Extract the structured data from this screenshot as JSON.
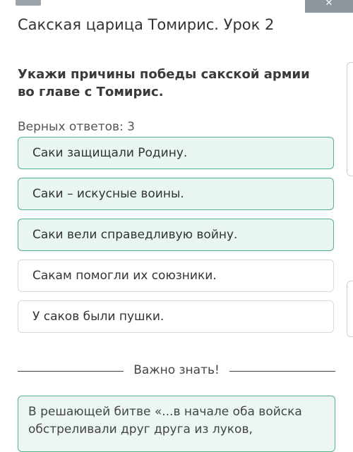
{
  "header": {
    "lesson_title": "Сакская царица Томирис. Урок 2"
  },
  "question": {
    "text": "Укажи причины победы сакской армии во главе с Томирис.",
    "correct_count_label": "Верных ответов: 3"
  },
  "answers": [
    {
      "label": "Саки защищали Родину.",
      "selected": true
    },
    {
      "label": "Саки – искусные воины.",
      "selected": true
    },
    {
      "label": "Саки вели справедливую войну.",
      "selected": true
    },
    {
      "label": "Сакам помогли их союзники.",
      "selected": false
    },
    {
      "label": "У саков были пушки.",
      "selected": false
    }
  ],
  "info": {
    "divider_label": "Важно знать!",
    "text": "В решающей битве «...в начале оба войска обстреливали друг друга из луков,"
  },
  "colors": {
    "selected_border": "#55b38b",
    "selected_bg": "#e8f5f0",
    "plain_border": "#d5dadd"
  }
}
